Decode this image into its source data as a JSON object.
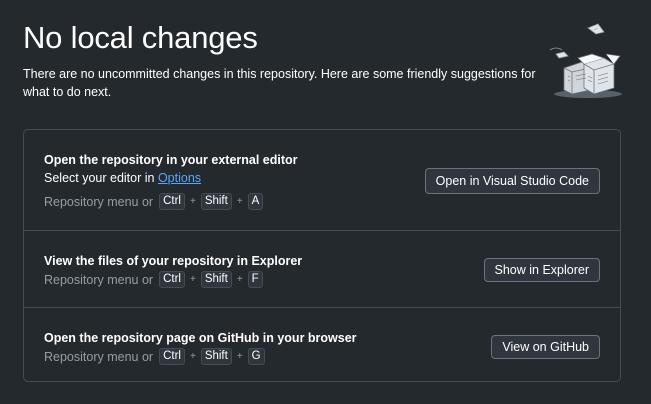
{
  "header": {
    "title": "No local changes",
    "subtitle": "There are no uncommitted changes in this repository. Here are some friendly suggestions for what to do next."
  },
  "suggestions": [
    {
      "title": "Open the repository in your external editor",
      "desc_prefix": "Select your editor in ",
      "desc_link": "Options",
      "shortcut_prefix": "Repository menu or",
      "keys": [
        "Ctrl",
        "Shift",
        "A"
      ],
      "button": "Open in Visual Studio Code"
    },
    {
      "title": "View the files of your repository in Explorer",
      "shortcut_prefix": "Repository menu or",
      "keys": [
        "Ctrl",
        "Shift",
        "F"
      ],
      "button": "Show in Explorer"
    },
    {
      "title": "Open the repository page on GitHub in your browser",
      "shortcut_prefix": "Repository menu or",
      "keys": [
        "Ctrl",
        "Shift",
        "G"
      ],
      "button": "View on GitHub"
    }
  ],
  "plus_glyph": "+",
  "colors": {
    "background": "#24292e",
    "border": "#444d56",
    "link": "#58a6ff",
    "muted": "#959da5"
  },
  "icons": {
    "illustration": "empty-repo-illustration"
  }
}
